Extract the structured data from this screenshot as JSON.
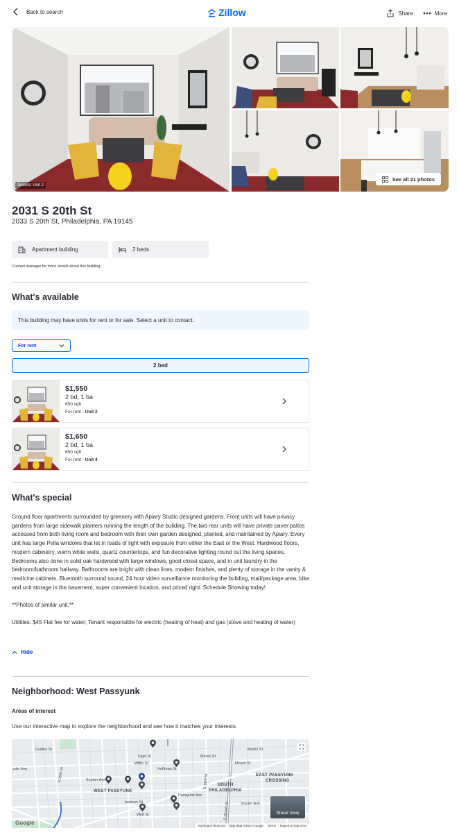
{
  "header": {
    "back_label": "Back to search",
    "logo_text": "Zillow",
    "share_label": "Share",
    "more_label": "More"
  },
  "gallery": {
    "source_label": "Source: Unit 2",
    "see_all_label": "See all 21 photos"
  },
  "listing": {
    "title": "2031 S 20th St",
    "address": "2033 S 20th St, Philadelphia, PA 19145",
    "facts": [
      {
        "label": "Apartment building",
        "icon": "building-icon"
      },
      {
        "label": "2 beds",
        "icon": "bed-icon"
      }
    ],
    "contact_note": "Contact manager for more details about this building."
  },
  "available": {
    "heading": "What's available",
    "info": "This building may have units for rent or for sale. Select a unit to contact.",
    "filter_value": "For rent",
    "bed_tab": "2 bed",
    "units": [
      {
        "price": "$1,550",
        "beds": "2 bd, 1 ba",
        "sqft": "650 sqft",
        "status_prefix": "For rent - ",
        "unit": "Unit 2"
      },
      {
        "price": "$1,650",
        "beds": "2 bd, 1 ba",
        "sqft": "650 sqft",
        "status_prefix": "For rent - ",
        "unit": "Unit 4"
      }
    ]
  },
  "special": {
    "heading": "What's special",
    "paragraphs": [
      "Ground floor apartments surrounded by greenery with Apiary Studio designed gardens. Front units will have privacy gardens from large sidewalk planters running the length of the building. The two rear units will have private paver patios accessed from both living room and bedroom with their own garden designed, planted, and maintained by Apiary. Every unit has large Pella windows that let in loads of light with exposure from either the East or the West. Hardwood floors, modern cabinetry, warm white walls, quartz countertops, and fun decorative lighting round out the living spaces. Bedrooms also done in solid oak hardwood with large windows, good closet space, and in unit laundry in the bedroom/bathroom hallway. Bathrooms are bright with clean lines, modern finishes, and plenty of storage in the vanity & medicine cabinets. Bluetooth surround sound, 24 hour video surveillance monitoring the building, mail/package area, bike and unit storage in the basement, super convenient location, and priced right. Schedule Showing today!",
      "**Photos of similar unit.**",
      "Utilities: $45 Flat fee for water; Tenant responsible for electric (heating of heat) and gas (stove and heating of water)"
    ],
    "hide_label": "Hide"
  },
  "neighborhood": {
    "heading": "Neighborhood: West Passyunk",
    "areas_heading": "Areas of interest",
    "areas_text": "Use our interactive map to explore the neighborhood and see how it matches your interests.",
    "map": {
      "labels": {
        "dudley": "Dudley St",
        "ryder": "yder Ave",
        "snyder": "Snyder Ave",
        "west_passyunk": "WEST PASSYUNK",
        "morris1": "Morris St",
        "morris2": "Morris St",
        "moore": "Moore St",
        "sigel": "Sigel St",
        "mifflin": "Mifflin St",
        "hoffman": "Hoffman St",
        "east_passyunk": "EAST PASSYUNK",
        "crossing": "CROSSING",
        "south": "SOUTH",
        "south_philly": "PHILADELPHIA",
        "passyunk_ave": "Passyunk Ave",
        "jackson": "Jackson St",
        "wolf": "Wolf St",
        "s20th": "S 20th St",
        "s16th": "S 16th St",
        "snyder2": "Snyder Ave",
        "broad": "S Broad St"
      },
      "street_view_label": "Street View",
      "google_label": "Google",
      "attribution": [
        "Keyboard shortcuts",
        "Map data ©2024 Google",
        "Terms",
        "Report a map error"
      ]
    }
  },
  "colors": {
    "brand": "#006aff",
    "link": "#0041d9",
    "info_bg": "#eef6ff",
    "fact_bg": "#f1f1f4"
  }
}
